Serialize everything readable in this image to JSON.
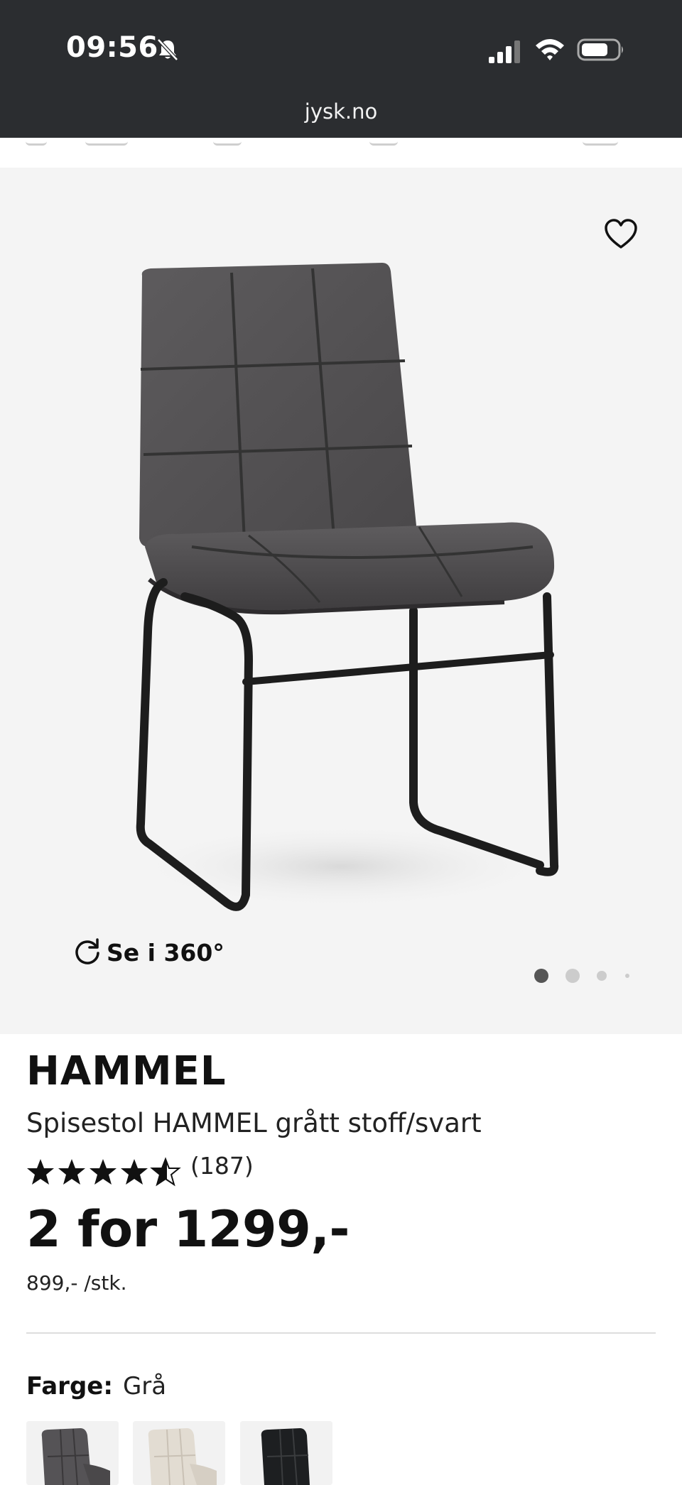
{
  "status_bar": {
    "time": "09:56",
    "url": "jysk.no"
  },
  "gallery": {
    "view_360_label": "Se i 360°",
    "image_count": 4,
    "active_image": 1
  },
  "product": {
    "brand": "HAMMEL",
    "name": "Spisestol HAMMEL grått stoff/svart",
    "rating": 4.5,
    "rating_max": 5,
    "reviews": "(187)",
    "price": "2 for 1299,-",
    "unit_price": "899,- /stk."
  },
  "color_selector": {
    "label": "Farge:",
    "value": "Grå",
    "options": [
      "grey-chair",
      "beige-chair",
      "black-chair"
    ]
  },
  "colors": {
    "status_bar_bg": "#2b2d30",
    "gallery_bg": "#f4f4f4",
    "text": "#111111",
    "dot_active": "#555555",
    "dot_inactive": "#cccccc"
  }
}
